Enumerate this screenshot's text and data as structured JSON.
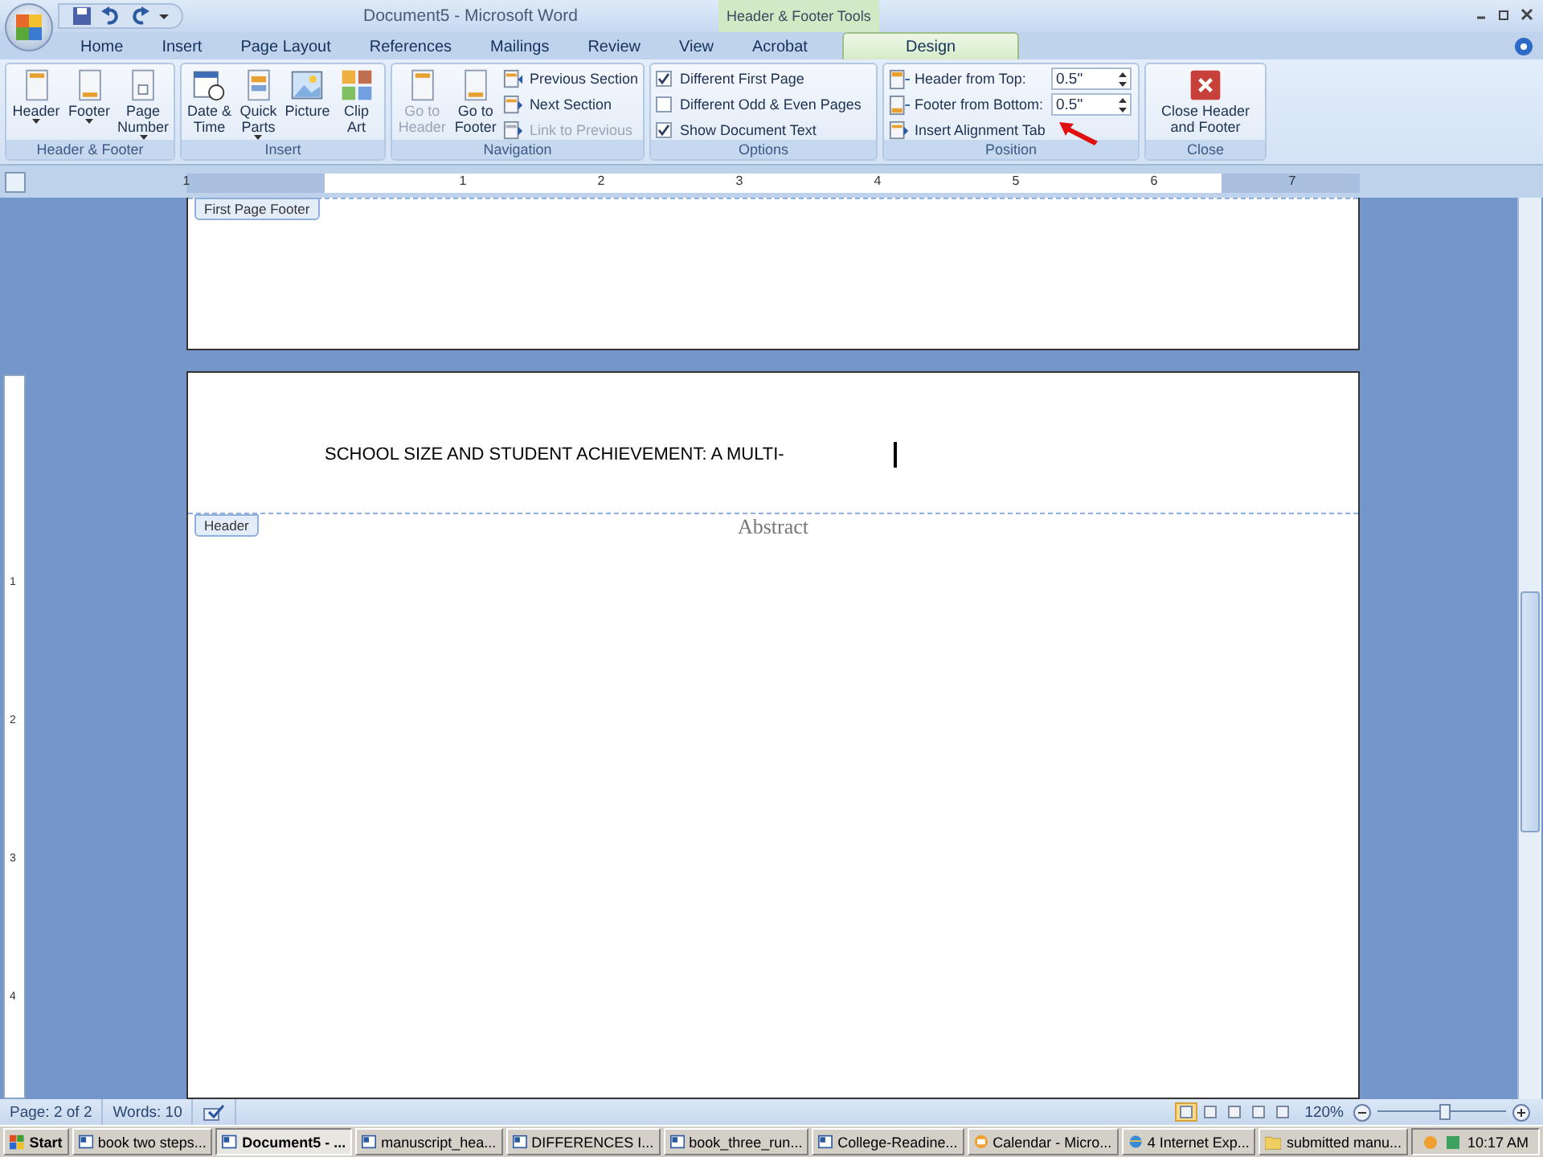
{
  "title_bar": {
    "title": "Document5 - Microsoft Word",
    "contextual_label": "Header & Footer Tools"
  },
  "tabs": [
    {
      "label": "Home",
      "selected": false
    },
    {
      "label": "Insert",
      "selected": false
    },
    {
      "label": "Page Layout",
      "selected": false
    },
    {
      "label": "References",
      "selected": false
    },
    {
      "label": "Mailings",
      "selected": false
    },
    {
      "label": "Review",
      "selected": false
    },
    {
      "label": "View",
      "selected": false
    },
    {
      "label": "Acrobat",
      "selected": false
    },
    {
      "label": "Design",
      "selected": true
    }
  ],
  "ribbon": {
    "groups": [
      {
        "label": "Header & Footer",
        "items": [
          {
            "kind": "large",
            "label": "Header",
            "dropdown": true,
            "disabled": false
          },
          {
            "kind": "large",
            "label": "Footer",
            "dropdown": true,
            "disabled": false
          },
          {
            "kind": "large",
            "label": "Page Number",
            "dropdown": true,
            "disabled": false
          }
        ]
      },
      {
        "label": "Insert",
        "items": [
          {
            "kind": "large",
            "label": "Date & Time",
            "dropdown": false,
            "disabled": false
          },
          {
            "kind": "large",
            "label": "Quick Parts",
            "dropdown": true,
            "disabled": false
          },
          {
            "kind": "large",
            "label": "Picture",
            "dropdown": false,
            "disabled": false
          },
          {
            "kind": "large",
            "label": "Clip Art",
            "dropdown": false,
            "disabled": false
          }
        ]
      },
      {
        "label": "Navigation",
        "items": [
          {
            "kind": "large",
            "label": "Go to Header",
            "dropdown": false,
            "disabled": true
          },
          {
            "kind": "large",
            "label": "Go to Footer",
            "dropdown": false,
            "disabled": false
          },
          {
            "kind": "small",
            "label": "Previous Section",
            "disabled": false
          },
          {
            "kind": "small",
            "label": "Next Section",
            "disabled": false
          },
          {
            "kind": "small",
            "label": "Link to Previous",
            "disabled": true
          }
        ]
      },
      {
        "label": "Options",
        "items": [
          {
            "kind": "checkbox",
            "label": "Different First Page",
            "checked": true
          },
          {
            "kind": "checkbox",
            "label": "Different Odd & Even Pages",
            "checked": false
          },
          {
            "kind": "checkbox",
            "label": "Show Document Text",
            "checked": true
          }
        ]
      },
      {
        "label": "Position",
        "items": [
          {
            "kind": "spin",
            "label": "Header from Top:",
            "value": "0.5\""
          },
          {
            "kind": "spin",
            "label": "Footer from Bottom:",
            "value": "0.5\""
          },
          {
            "kind": "small",
            "label": "Insert Alignment Tab",
            "disabled": false
          }
        ]
      },
      {
        "label": "Close",
        "items": [
          {
            "kind": "large",
            "label": "Close Header and Footer",
            "dropdown": false,
            "disabled": false
          }
        ]
      }
    ]
  },
  "ruler": {
    "numbers": [
      "1",
      "1",
      "2",
      "3",
      "4",
      "5",
      "6",
      "7"
    ]
  },
  "vertical_ruler": {
    "numbers": [
      "1",
      "2",
      "3",
      "4"
    ]
  },
  "document": {
    "footer_tag": "First Page Footer",
    "header_text": "SCHOOL SIZE AND STUDENT ACHIEVEMENT: A MULTI-",
    "header_tag": "Header",
    "body_text": "Abstract"
  },
  "status_bar": {
    "page": "Page: 2 of 2",
    "words": "Words: 10",
    "views": [
      {
        "selected": true
      },
      {
        "selected": false
      },
      {
        "selected": false
      },
      {
        "selected": false
      },
      {
        "selected": false
      }
    ],
    "zoom": "120%",
    "zoom_level": {
      "level": 0.52
    }
  },
  "taskbar": {
    "start": "Start",
    "items": [
      {
        "kind": "word",
        "label": "book two steps...",
        "selected": false
      },
      {
        "kind": "word",
        "label": "Document5 - ...",
        "selected": true
      },
      {
        "kind": "word",
        "label": "manuscript_hea...",
        "selected": false
      },
      {
        "kind": "word",
        "label": "DIFFERENCES I...",
        "selected": false
      },
      {
        "kind": "word",
        "label": "book_three_run...",
        "selected": false
      },
      {
        "kind": "word",
        "label": "College-Readine...",
        "selected": false
      },
      {
        "kind": "outlook",
        "label": "Calendar - Micro...",
        "selected": false
      },
      {
        "kind": "ie",
        "label": "4 Internet Exp...",
        "selected": false
      },
      {
        "kind": "folder",
        "label": "submitted manu...",
        "selected": false
      }
    ],
    "clock": "10:17 AM"
  }
}
